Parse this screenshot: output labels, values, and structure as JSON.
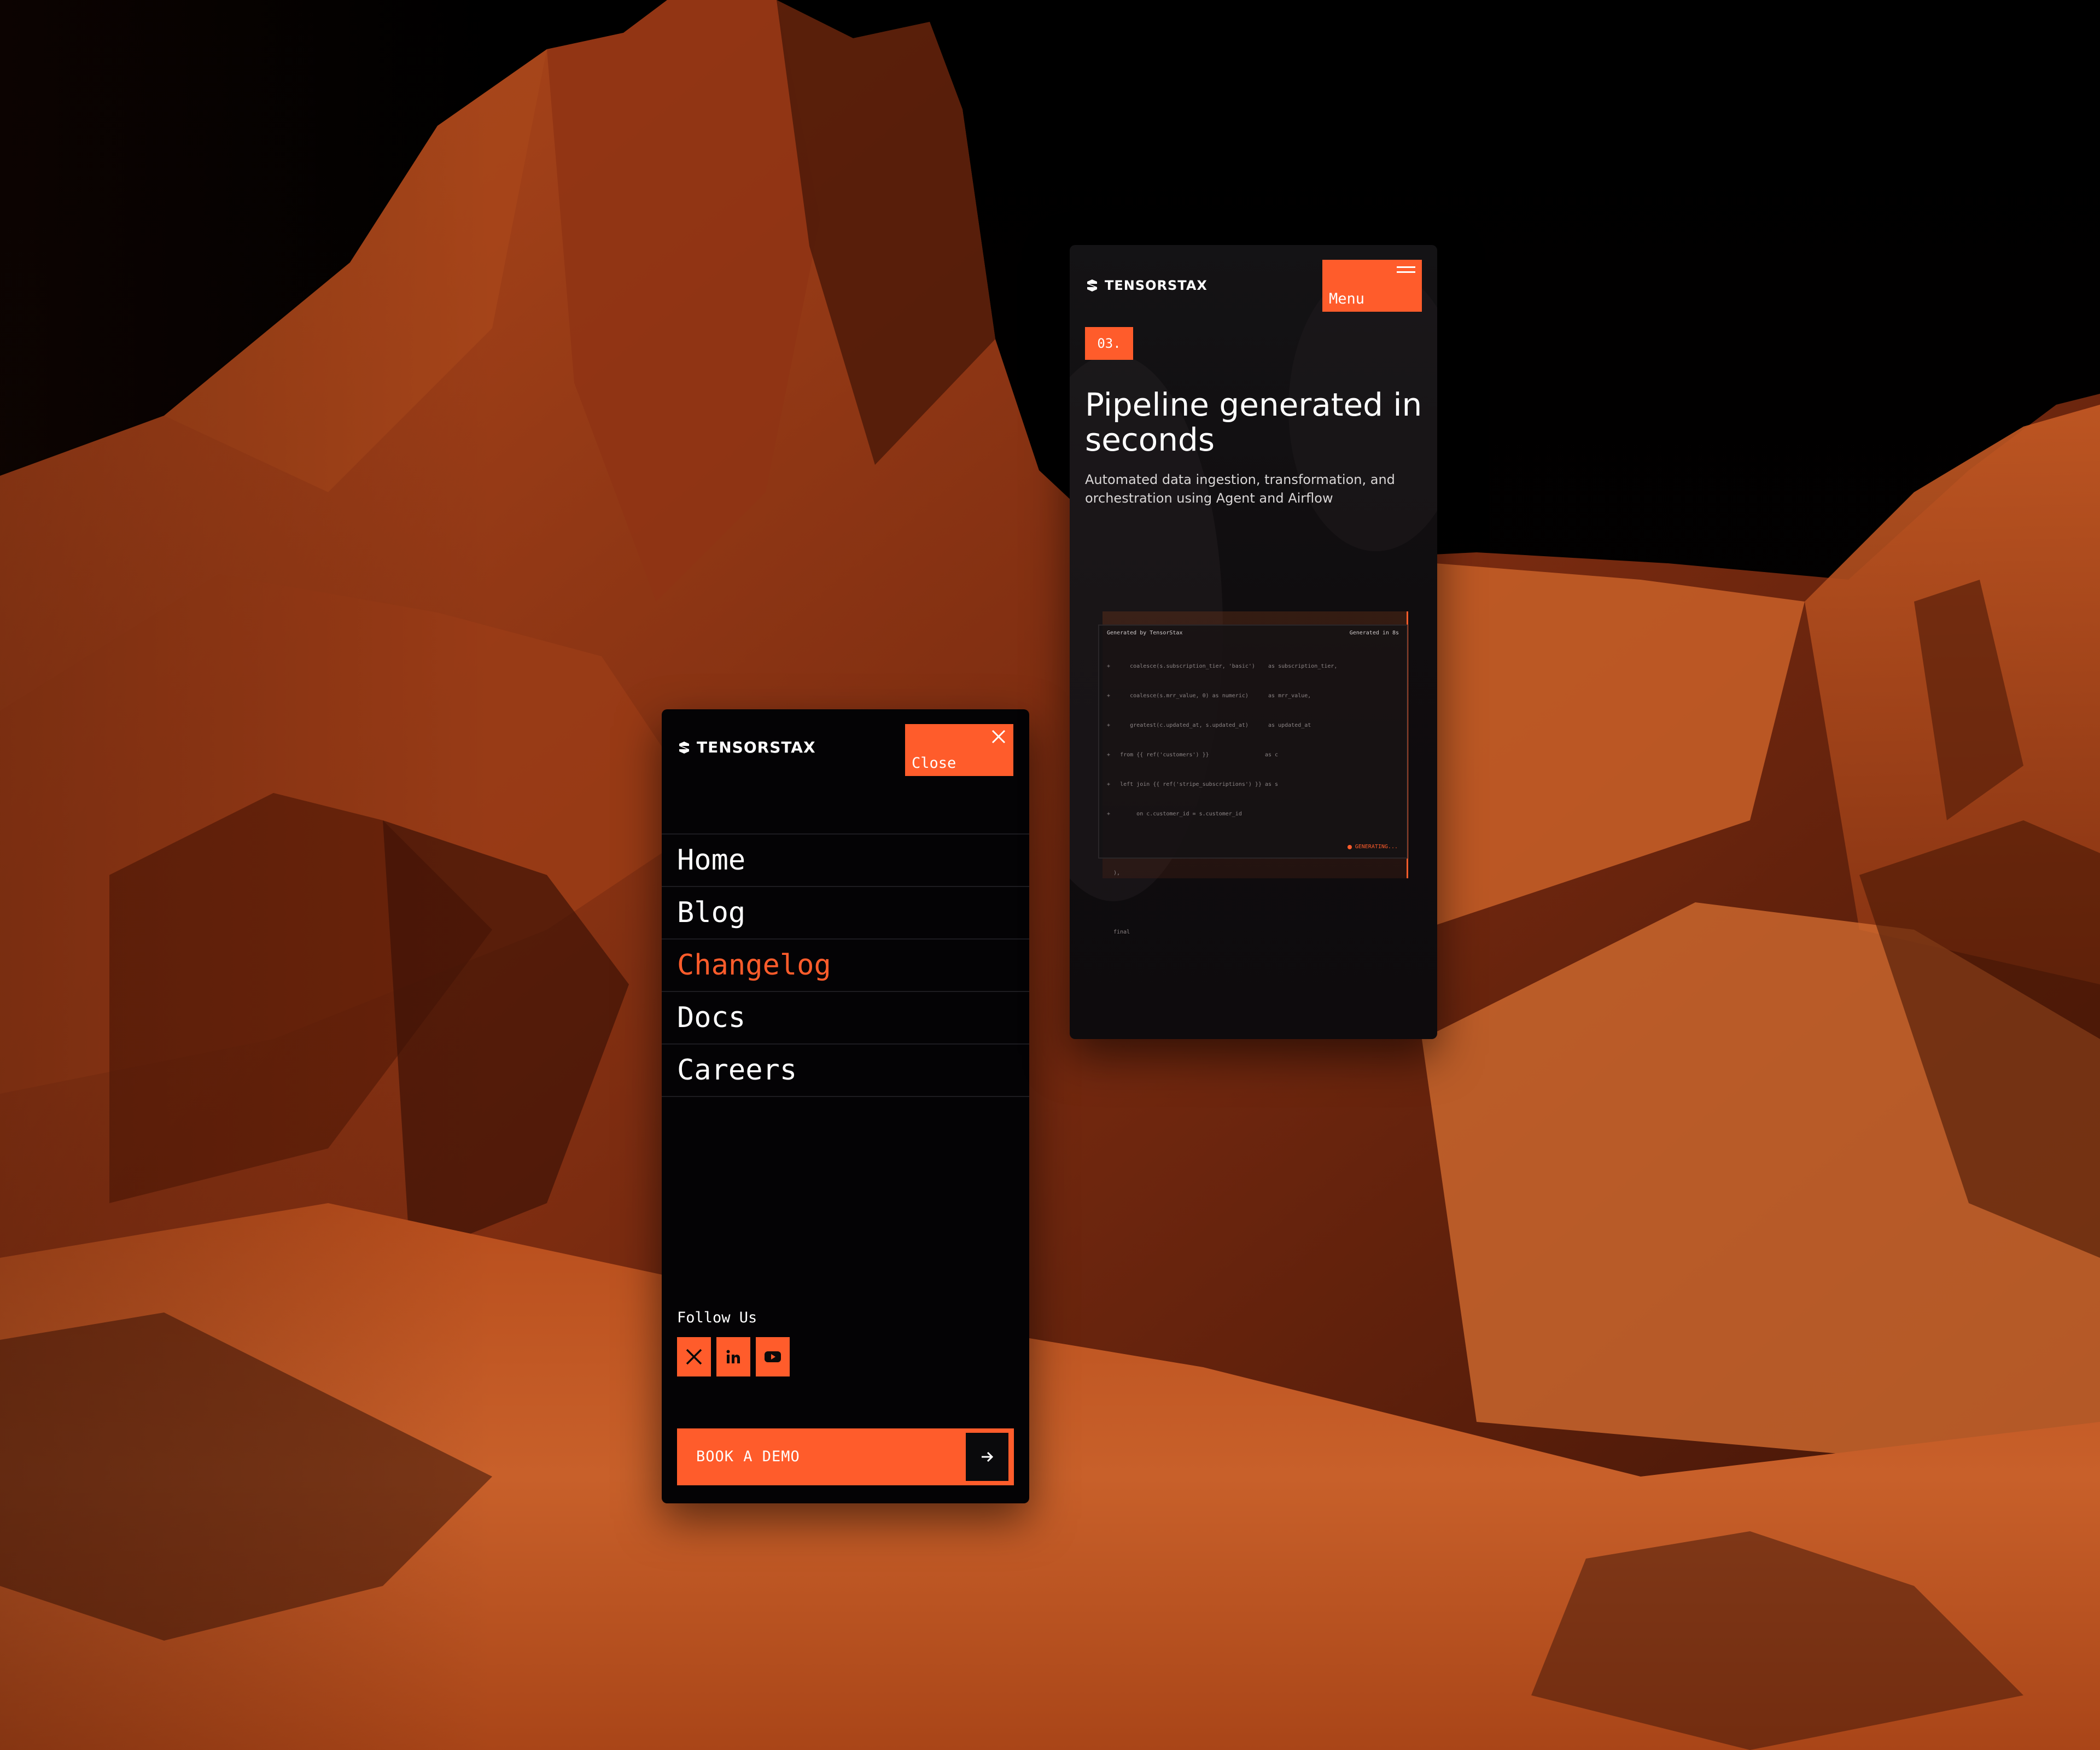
{
  "brand": {
    "name": "TENSORSTAX",
    "accent": "#ff5c2b",
    "background": "#040305"
  },
  "menu_screen": {
    "close_label": "Close",
    "nav": [
      {
        "label": "Home",
        "active": false
      },
      {
        "label": "Blog",
        "active": false
      },
      {
        "label": "Changelog",
        "active": true
      },
      {
        "label": "Docs",
        "active": false
      },
      {
        "label": "Careers",
        "active": false
      }
    ],
    "follow_label": "Follow Us",
    "socials": [
      {
        "icon": "x-icon"
      },
      {
        "icon": "linkedin-icon"
      },
      {
        "icon": "youtube-icon"
      }
    ],
    "cta_label": "BOOK A DEMO",
    "cta_icon": "arrow-right-icon"
  },
  "hero_screen": {
    "menu_label": "Menu",
    "step": "03.",
    "title": "Pipeline generated in seconds",
    "subtitle": "Automated data ingestion, transformation, and orchestration using Agent and Airflow",
    "code_card": {
      "header_left": "Generated by TensorStax",
      "header_right": "Generated in 8s",
      "lines": [
        "+      coalesce(s.subscription_tier, 'basic')    as subscription_tier,",
        "+      coalesce(s.mrr_value, 0) as numeric)      as mrr_value,",
        "+      greatest(c.updated_at, s.updated_at)      as updated_at",
        "+   from {{ ref('customers') }}                 as c",
        "+   left join {{ ref('stripe_subscriptions') }} as s",
        "+        on c.customer_id = s.customer_id",
        "",
        "  ),",
        "",
        "  final"
      ],
      "status": "GENERATING..."
    }
  }
}
